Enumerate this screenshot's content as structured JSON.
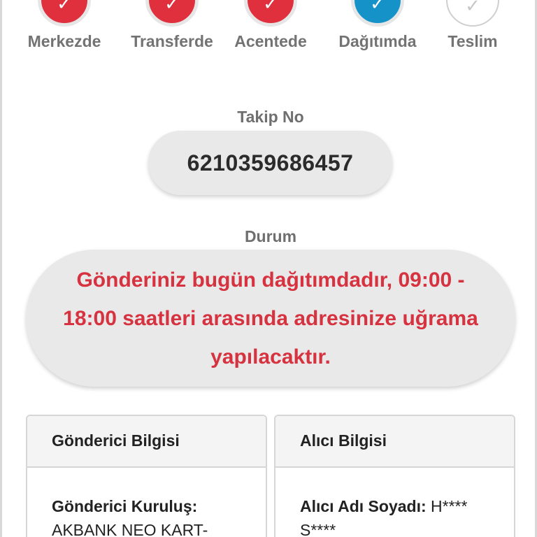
{
  "steps": [
    {
      "label": "Merkezde",
      "state": "done",
      "icon": "check-icon"
    },
    {
      "label": "Transferde",
      "state": "done",
      "icon": "check-icon"
    },
    {
      "label": "Acentede",
      "state": "done",
      "icon": "check-icon"
    },
    {
      "label": "Dağıtımda",
      "state": "active",
      "icon": "check-icon"
    },
    {
      "label": "Teslim",
      "state": "pending",
      "icon": "check-icon"
    }
  ],
  "check_glyph": "✓",
  "tracking": {
    "label": "Takip No",
    "value": "6210359686457"
  },
  "status": {
    "label": "Durum",
    "text": "Gönderiniz bugün dağıtımdadır, 09:00 - 18:00 saatleri arasında adresinize uğrama yapılacaktır."
  },
  "sender": {
    "title": "Gönderici Bilgisi",
    "key": "Gönderici Kuruluş:",
    "value": "AKBANK NEO KART-"
  },
  "receiver": {
    "title": "Alıcı Bilgisi",
    "key": "Alıcı Adı Soyadı:",
    "value": "H**** S****"
  },
  "colors": {
    "done": "#e0303d",
    "active": "#1593c9",
    "status_text": "#d6323f",
    "pill_bg": "#e9e9ea"
  }
}
